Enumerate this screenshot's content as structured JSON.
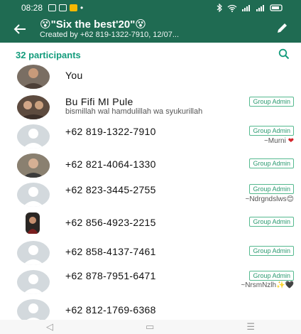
{
  "status_bar": {
    "time": "08:28"
  },
  "header": {
    "title": "😵\"Six the best'20\"😵",
    "subtitle": "Created by +62 819-1322-7910, 12/07..."
  },
  "participants": {
    "count_label": "32 participants"
  },
  "members": [
    {
      "name": "You",
      "status": "",
      "badge": "",
      "pushname": ""
    },
    {
      "name": "Bu Fifi MI Pule",
      "status": "bismillah wal hamdulillah wa syukurillah",
      "badge": "Group Admin",
      "pushname": ""
    },
    {
      "name": "+62 819-1322-7910",
      "status": "",
      "badge": "Group Admin",
      "pushname": "~Murni"
    },
    {
      "name": "+62 821-4064-1330",
      "status": "",
      "badge": "Group Admin",
      "pushname": ""
    },
    {
      "name": "+62 823-3445-2755",
      "status": "",
      "badge": "Group Admin",
      "pushname": "~Ndrgndslws😊"
    },
    {
      "name": "+62 856-4923-2215",
      "status": "",
      "badge": "Group Admin",
      "pushname": ""
    },
    {
      "name": "+62 858-4137-7461",
      "status": "",
      "badge": "Group Admin",
      "pushname": ""
    },
    {
      "name": "+62 878-7951-6471",
      "status": "",
      "badge": "Group Admin",
      "pushname": "~NrsmNzlh✨🖤"
    },
    {
      "name": "+62 812-1769-6368",
      "status": "",
      "badge": "",
      "pushname": ""
    }
  ],
  "nav": {
    "back": "◁",
    "home": "▭",
    "recents": "☰"
  },
  "colors": {
    "primary": "#1f6b52",
    "accent": "#139c7c"
  }
}
